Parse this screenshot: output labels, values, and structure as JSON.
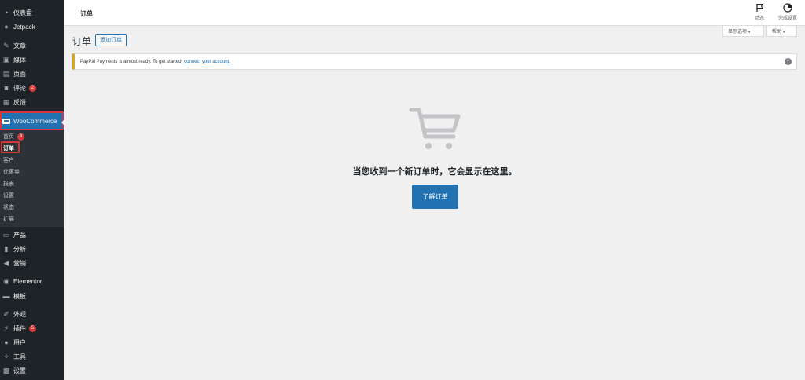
{
  "sidebar": {
    "items": [
      {
        "label": "仪表盘",
        "icon": "dashboard-icon"
      },
      {
        "label": "Jetpack",
        "icon": "jetpack-icon"
      },
      {
        "label": "文章",
        "icon": "pin-icon"
      },
      {
        "label": "媒体",
        "icon": "media-icon"
      },
      {
        "label": "页面",
        "icon": "page-icon"
      },
      {
        "label": "评论",
        "icon": "comment-icon",
        "badge": "2"
      },
      {
        "label": "反馈",
        "icon": "feedback-icon"
      },
      {
        "label": "WooCommerce",
        "icon": "woocommerce-icon"
      },
      {
        "label": "产品",
        "icon": "archive-icon"
      },
      {
        "label": "分析",
        "icon": "chart-icon"
      },
      {
        "label": "营销",
        "icon": "megaphone-icon"
      },
      {
        "label": "Elementor",
        "icon": "elementor-icon"
      },
      {
        "label": "模板",
        "icon": "folder-icon"
      },
      {
        "label": "外观",
        "icon": "brush-icon"
      },
      {
        "label": "插件",
        "icon": "plugin-icon",
        "badge": "5"
      },
      {
        "label": "用户",
        "icon": "user-icon"
      },
      {
        "label": "工具",
        "icon": "wrench-icon"
      },
      {
        "label": "设置",
        "icon": "settings-icon"
      }
    ],
    "submenu": [
      {
        "label": "首页",
        "badge": "4"
      },
      {
        "label": "订单"
      },
      {
        "label": "客户"
      },
      {
        "label": "优惠券"
      },
      {
        "label": "报表"
      },
      {
        "label": "设置"
      },
      {
        "label": "状态"
      },
      {
        "label": "扩展"
      }
    ]
  },
  "topbar": {
    "title": "订单",
    "activity_label": "动态",
    "setup_label": "完成设置"
  },
  "screen_options": {
    "label": "显示选项 ▾",
    "help": "帮助 ▾"
  },
  "page": {
    "title": "订单",
    "add_button": "添加订单"
  },
  "notice": {
    "text": "PayPal Payments is almost ready. To get started,",
    "link": "connect your account",
    "suffix": ".",
    "close": "×"
  },
  "empty_state": {
    "message": "当您收到一个新订单时，它会显示在这里。",
    "button": "了解订单"
  },
  "colors": {
    "accent": "#2271b1",
    "sidebar": "#1d2327",
    "badge": "#d63638",
    "notice_border": "#dba617"
  }
}
